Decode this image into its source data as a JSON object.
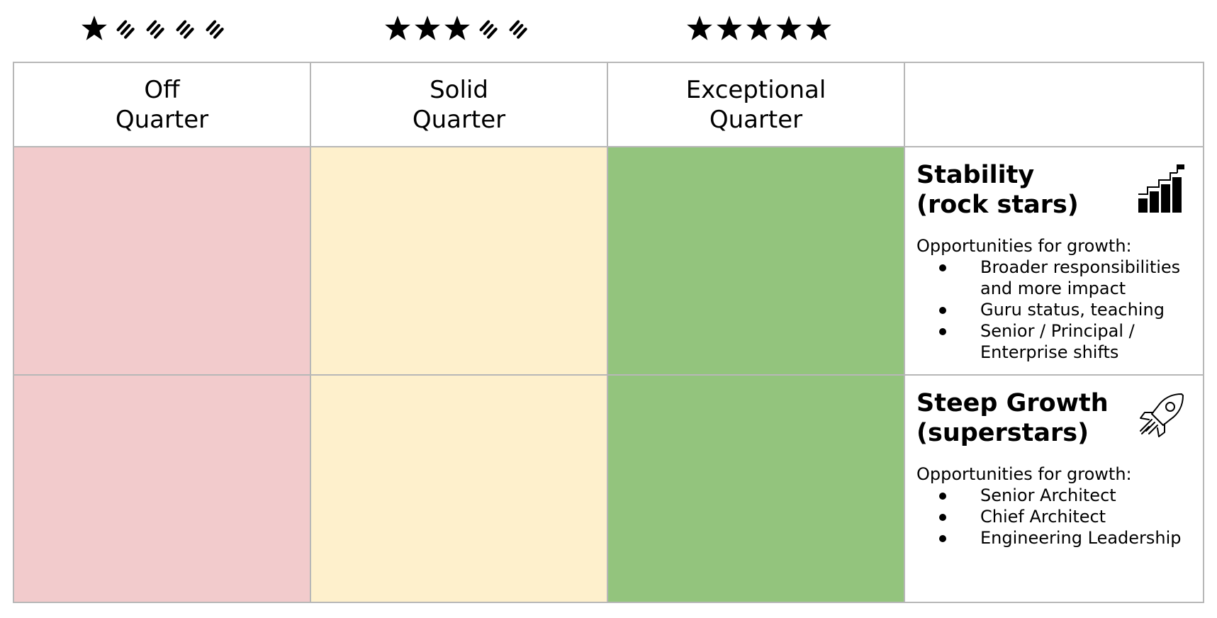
{
  "ratings": [
    {
      "filled": 1,
      "total": 5
    },
    {
      "filled": 3,
      "total": 5
    },
    {
      "filled": 5,
      "total": 5
    }
  ],
  "columns": [
    {
      "line1": "Off",
      "line2": "Quarter",
      "color": "#f2cbcc"
    },
    {
      "line1": "Solid",
      "line2": "Quarter",
      "color": "#fef0cc"
    },
    {
      "line1": "Exceptional",
      "line2": "Quarter",
      "color": "#93c47d"
    }
  ],
  "rows": [
    {
      "title_line1": "Stability",
      "title_line2": "(rock stars)",
      "icon": "growth-stairs-icon",
      "intro": "Opportunities for growth:",
      "items": [
        "Broader responsibilities and more impact",
        "Guru status, teaching",
        "Senior / Principal / Enterprise shifts"
      ]
    },
    {
      "title_line1": "Steep Growth",
      "title_line2": "(superstars)",
      "icon": "rocket-icon",
      "intro": "Opportunities for growth:",
      "items": [
        "Senior Architect",
        "Chief Architect",
        "Engineering Leadership"
      ]
    }
  ]
}
